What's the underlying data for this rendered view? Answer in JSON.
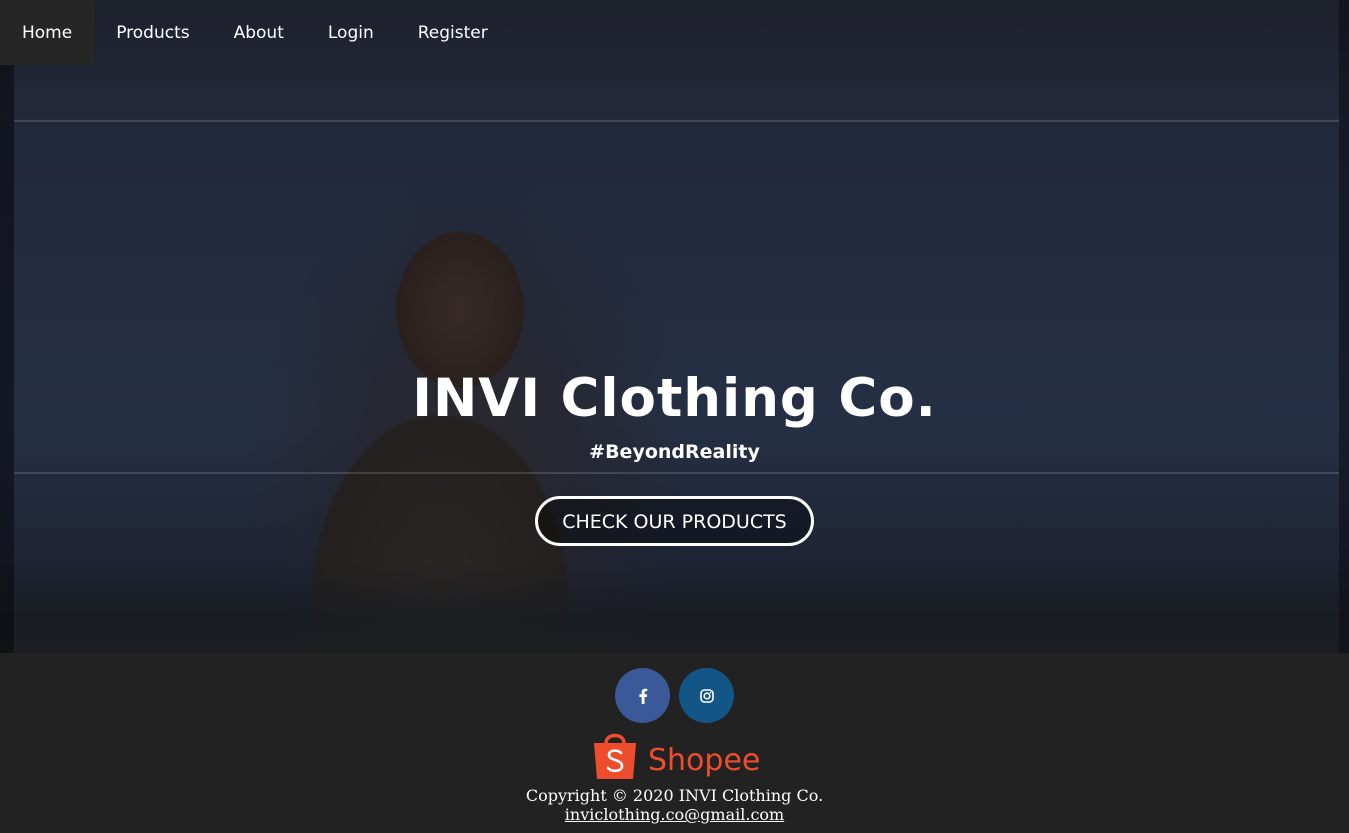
{
  "nav": {
    "items": [
      {
        "label": "Home",
        "active": true
      },
      {
        "label": "Products",
        "active": false
      },
      {
        "label": "About",
        "active": false
      },
      {
        "label": "Login",
        "active": false
      },
      {
        "label": "Register",
        "active": false
      }
    ]
  },
  "hero": {
    "title": "INVI Clothing Co.",
    "tagline": "#BeyondReality",
    "cta_label": "CHECK OUR PRODUCTS"
  },
  "footer": {
    "social": [
      {
        "icon": "facebook-icon",
        "color": "#3b5998"
      },
      {
        "icon": "instagram-icon",
        "color": "#125688"
      }
    ],
    "shopee_label": "Shopee",
    "shopee_color": "#ee4d2d",
    "copyright": "Copyright © 2020 INVI Clothing Co.",
    "email": "inviclothing.co@gmail.com"
  }
}
